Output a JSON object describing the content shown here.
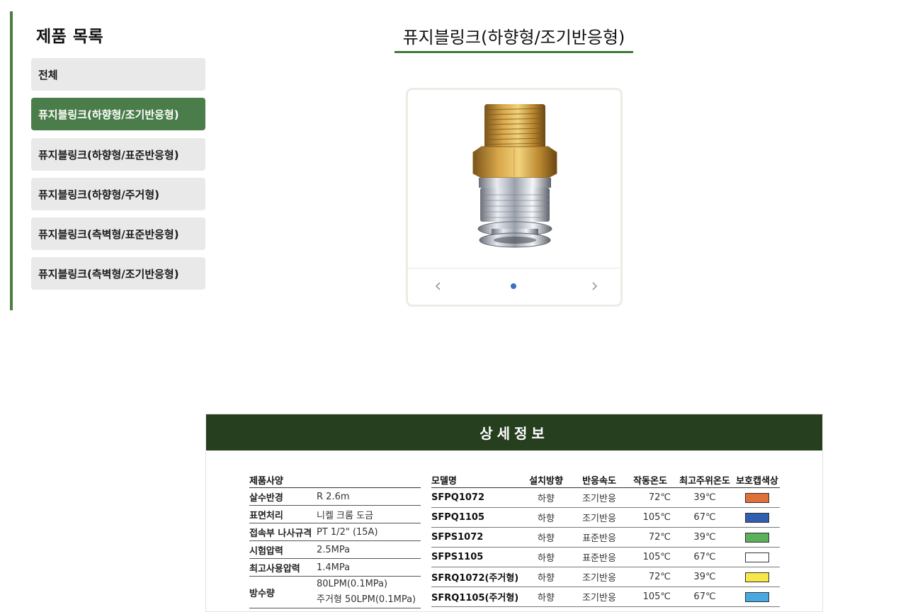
{
  "sidebar": {
    "title": "제품 목록",
    "items": [
      {
        "label": "전체",
        "active": false
      },
      {
        "label": "퓨지블링크(하향형/조기반응형)",
        "active": true
      },
      {
        "label": "퓨지블링크(하향형/표준반응형)",
        "active": false
      },
      {
        "label": "퓨지블링크(하향형/주거형)",
        "active": false
      },
      {
        "label": "퓨지블링크(측벽형/표준반응형)",
        "active": false
      },
      {
        "label": "퓨지블링크(측벽형/조기반응형)",
        "active": false
      }
    ]
  },
  "product": {
    "title": "퓨지블링크(하향형/조기반응형)",
    "carousel": {
      "prev_icon": "chevron-left-icon",
      "next_icon": "chevron-right-icon",
      "dots": 1,
      "active_dot": 1
    }
  },
  "detail": {
    "header": "상세정보",
    "spec": {
      "heading": "제품사양",
      "rows": [
        {
          "key": "살수반경",
          "value": "R 2.6m"
        },
        {
          "key": "표면처리",
          "value": "니켈 크롬 도금"
        },
        {
          "key": "접속부 나사규격",
          "value": "PT 1/2\" (15A)"
        },
        {
          "key": "시험압력",
          "value": "2.5MPa"
        },
        {
          "key": "최고사용압력",
          "value": "1.4MPa"
        },
        {
          "key": "방수량",
          "value": "80LPM(0.1MPa)",
          "value2": "주거형 50LPM(0.1MPa)"
        }
      ]
    },
    "models": {
      "headers": [
        "모델명",
        "설치방향",
        "반응속도",
        "작동온도",
        "최고주위온도",
        "보호캡색상"
      ],
      "rows": [
        {
          "model": "SFPQ1072",
          "direction": "하향",
          "speed": "조기반응",
          "op_temp": "72℃",
          "max_temp": "39℃",
          "cap_color": "#e0703a"
        },
        {
          "model": "SFPQ1105",
          "direction": "하향",
          "speed": "조기반응",
          "op_temp": "105℃",
          "max_temp": "67℃",
          "cap_color": "#2f5fae"
        },
        {
          "model": "SFPS1072",
          "direction": "하향",
          "speed": "표준반응",
          "op_temp": "72℃",
          "max_temp": "39℃",
          "cap_color": "#5cb05a"
        },
        {
          "model": "SFPS1105",
          "direction": "하향",
          "speed": "표준반응",
          "op_temp": "105℃",
          "max_temp": "67℃",
          "cap_color": "#ffffff"
        },
        {
          "model": "SFRQ1072(주거형)",
          "direction": "하향",
          "speed": "조기반응",
          "op_temp": "72℃",
          "max_temp": "39℃",
          "cap_color": "#f4e84a"
        },
        {
          "model": "SFRQ1105(주거형)",
          "direction": "하향",
          "speed": "조기반응",
          "op_temp": "105℃",
          "max_temp": "67℃",
          "cap_color": "#4aa8e0"
        }
      ]
    }
  },
  "colors": {
    "accent_green": "#4b7d3f",
    "active_item": "#4b7d4a",
    "detail_header_bg": "#253f1f",
    "carousel_dot": "#3b6fc4"
  }
}
